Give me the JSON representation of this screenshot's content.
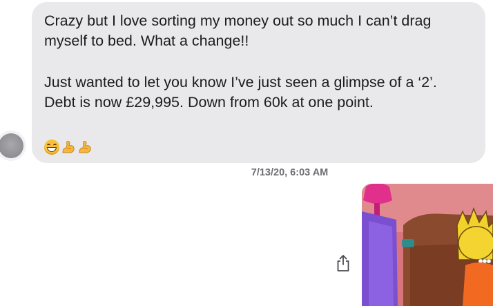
{
  "message": {
    "lines_para1": [
      "Crazy but I love sorting my money out so much I can’t drag",
      "myself to bed. What a change!!"
    ],
    "lines_para2": [
      "Just wanted to let you know I’ve just seen a glimpse of a ‘2’.",
      "Debt is now £29,995. Down from 60k at one point."
    ],
    "emojis": [
      "grinning-face",
      "flexed-biceps",
      "flexed-biceps"
    ]
  },
  "timestamp": "7/13/20, 6:03 AM",
  "attachment": {
    "type": "gif",
    "description_icon": "gif-image"
  },
  "colors": {
    "bubble": "#e9e9eb",
    "accent_pink": "#e0308c",
    "purple": "#7a4fd0"
  }
}
